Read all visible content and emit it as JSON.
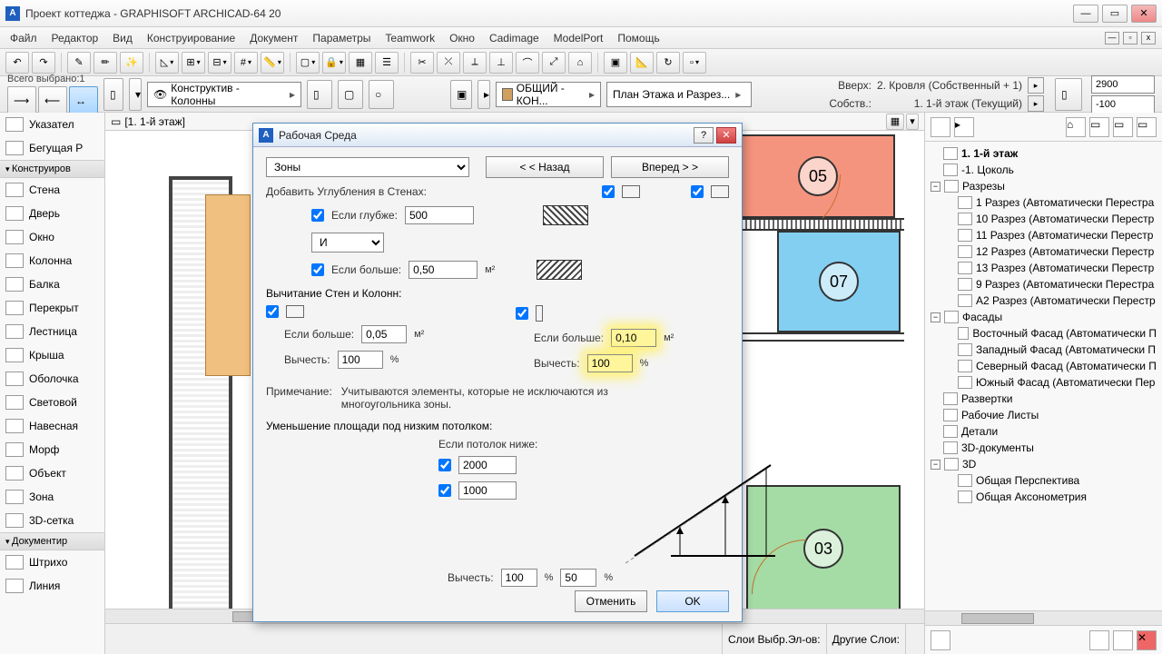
{
  "window": {
    "title": "Проект коттеджа - GRAPHISOFT ARCHICAD-64 20"
  },
  "menu": [
    "Файл",
    "Редактор",
    "Вид",
    "Конструирование",
    "Документ",
    "Параметры",
    "Teamwork",
    "Окно",
    "Cadimage",
    "ModelPort",
    "Помощь"
  ],
  "toolbar2": {
    "selected_label": "Всего выбрано:1",
    "combo_konstr": "Конструктив - Колонны",
    "combo_layer": "ОБЩИЙ - КОН...",
    "combo_plan": "План Этажа и Разрез...",
    "vverh_lbl": "Вверх:",
    "vverh_val": "2. Кровля (Собственный + 1)",
    "sobstv_lbl": "Собств.:",
    "sobstv_val": "1. 1-й этаж (Текущий)",
    "num1": "2900",
    "num2": "-100"
  },
  "toolbox": {
    "sections": {
      "pointer": "Указател",
      "marquee": "Бегущая Р",
      "construct": "Конструиров",
      "document": "Документир"
    },
    "tools": [
      "Стена",
      "Дверь",
      "Окно",
      "Колонна",
      "Балка",
      "Перекрыт",
      "Лестница",
      "Крыша",
      "Оболочка",
      "Световой",
      "Навесная",
      "Морф",
      "Объект",
      "Зона",
      "3D-сетка"
    ],
    "doc_tools": [
      "Штрихо",
      "Линия"
    ]
  },
  "canvas": {
    "tab": "[1. 1-й этаж]",
    "zones": {
      "z05": "05",
      "z07": "07",
      "z03": "03"
    },
    "footer": {
      "sel": "Слои Выбр.Эл-ов:",
      "other": "Другие Слои:"
    }
  },
  "navigator": {
    "root": "1. 1-й этаж",
    "sub": "-1. Цоколь",
    "razrezy": "Разрезы",
    "razrez_items": [
      "1 Разрез (Автоматически Перестра",
      "10 Разрез (Автоматически Перестр",
      "11 Разрез (Автоматически Перестр",
      "12 Разрез (Автоматически Перестр",
      "13 Разрез (Автоматически Перестр",
      "9 Разрез (Автоматически Перестра",
      "А2 Разрез (Автоматически Перестр"
    ],
    "fasady": "Фасады",
    "fasad_items": [
      "Восточный Фасад (Автоматически П",
      "Западный Фасад (Автоматически П",
      "Северный Фасад (Автоматически П",
      "Южный Фасад (Автоматически Пер"
    ],
    "other": [
      "Развертки",
      "Рабочие Листы",
      "Детали",
      "3D-документы"
    ],
    "3d": "3D",
    "3d_items": [
      "Общая Перспектива",
      "Общая Аксонометрия"
    ]
  },
  "dialog": {
    "title": "Рабочая Среда",
    "dropdown": "Зоны",
    "back": "< < Назад",
    "forward": "Вперед > >",
    "add_recess": "Добавить Углубления в Стенах:",
    "if_deeper": "Если глубже:",
    "if_deeper_val": "500",
    "and": "И",
    "if_larger1": "Если больше:",
    "if_larger1_val": "0,50",
    "unit_m2": "м²",
    "subtract": "Вычитание Стен и Колонн:",
    "if_larger2": "Если больше:",
    "if_larger2_val": "0,05",
    "subtract_lbl": "Вычесть:",
    "subtract_val1": "100",
    "pct": "%",
    "if_larger3": "Если больше:",
    "if_larger3_val": "0,10",
    "subtract_val2": "100",
    "note_lbl": "Примечание:",
    "note_txt": "Учитываются элементы, которые не исключаются из многоугольника зоны.",
    "reduce": "Уменьшение площади под низким потолком:",
    "if_ceiling": "Если потолок ниже:",
    "h1": "2000",
    "h2": "1000",
    "sub3_lbl": "Вычесть:",
    "sub3_v1": "100",
    "sub3_v2": "50",
    "cancel": "Отменить",
    "ok": "OK"
  }
}
